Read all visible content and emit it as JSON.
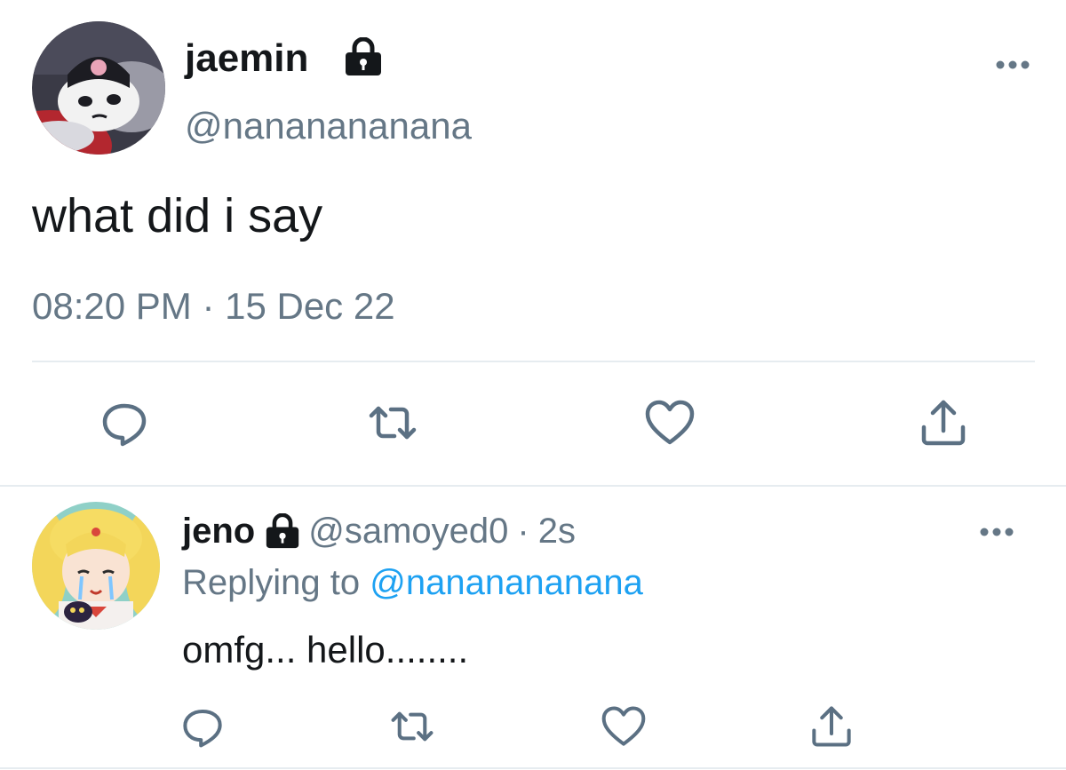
{
  "main_tweet": {
    "display_name": "jaemin",
    "handle": "@nananananana",
    "text": "what did i say",
    "timestamp": "08:20 PM · 15 Dec 22",
    "protected_icon": "lock-icon",
    "more_icon": "more-icon",
    "actions": [
      "reply-icon",
      "retweet-icon",
      "like-icon",
      "share-icon"
    ]
  },
  "reply_tweet": {
    "display_name": "jeno",
    "handle": "@samoyed0",
    "separator": "·",
    "time": "2s",
    "replying_prefix": "Replying to",
    "replying_to": "@nananananana",
    "text": "omfg... hello........",
    "protected_icon": "lock-icon",
    "more_icon": "more-icon",
    "actions": [
      "reply-icon",
      "retweet-icon",
      "like-icon",
      "share-icon"
    ]
  },
  "colors": {
    "primary_text": "#14171a",
    "secondary_text": "#657786",
    "link": "#1da1f2",
    "divider": "#e6ecf0",
    "icon": "#5b7083"
  }
}
